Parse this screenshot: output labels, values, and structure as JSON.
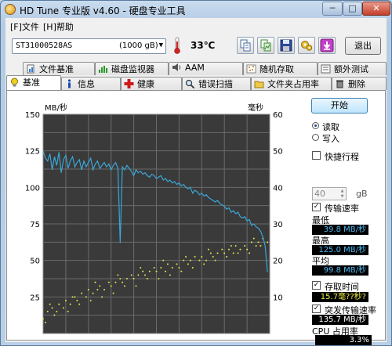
{
  "window": {
    "title": "HD Tune 专业版 v4.60 - 硬盘专业工具",
    "min_label": "─",
    "max_label": "□",
    "close_label": "✕"
  },
  "menu": [
    "[F]文件",
    "[H]帮助"
  ],
  "toolbar": {
    "drive_name": "ST31000528AS",
    "drive_capacity": "(1000 gB)",
    "temperature": "33℃",
    "exit_label": "退出",
    "buttons": [
      "copy-text-icon",
      "copy-screenshot-icon",
      "save-icon",
      "options-icon",
      "download-icon"
    ]
  },
  "tabs_row1": [
    "文件基准",
    "磁盘监视器",
    "AAM",
    "随机存取",
    "额外测试"
  ],
  "tabs_row2": [
    "基准",
    "信息",
    "健康",
    "错误扫描",
    "文件夹占用率",
    "删除"
  ],
  "side": {
    "start_label": "开始",
    "read_label": "读取",
    "write_label": "写入",
    "read_selected": true,
    "shortstroke_label": "快捷行程",
    "shortstroke_checked": false,
    "shortstroke_value": "40",
    "shortstroke_unit": "gB",
    "transfer_label": "传输速率",
    "transfer_checked": true,
    "min_label": "最低",
    "min_value": "39.8 MB/秒",
    "max_label": "最高",
    "max_value": "125.0 MB/秒",
    "avg_label": "平均",
    "avg_value": "99.8 MB/秒",
    "access_label": "存取时间",
    "access_checked": true,
    "access_value": "15.7毫??秒?",
    "burst_label": "突发传输速率",
    "burst_checked": true,
    "burst_value": "135.7 MB/秒",
    "cpu_label": "CPU 占用率",
    "cpu_value": "3.3%"
  },
  "colors": {
    "plot_bg": "#3a3a3a",
    "grid": "#6b6b6b",
    "transfer_line": "#3aa6d8",
    "access_dots": "#e6e650"
  },
  "chart_data": {
    "type": "line",
    "left_axis_label": "MB/秒",
    "right_axis_label": "毫秒",
    "y_left_ticks": [
      150,
      125,
      100,
      75,
      50,
      25
    ],
    "y_right_ticks": [
      60,
      50,
      40,
      30,
      20,
      10
    ],
    "y_left_range": [
      0,
      150
    ],
    "y_right_range": [
      0,
      60
    ],
    "x_range": [
      0,
      100
    ],
    "grid": true,
    "series": [
      {
        "name": "传输速率",
        "axis": "left",
        "x": [
          0,
          1,
          2,
          3,
          4,
          5,
          6,
          7,
          8,
          9,
          10,
          11,
          12,
          13,
          14,
          15,
          16,
          17,
          18,
          19,
          20,
          21,
          22,
          23,
          24,
          25,
          26,
          27,
          28,
          29,
          30,
          31,
          32,
          33,
          34,
          35,
          36,
          37,
          38,
          39,
          40,
          41,
          42,
          43,
          44,
          45,
          46,
          47,
          48,
          49,
          50,
          51,
          52,
          53,
          54,
          55,
          56,
          57,
          58,
          59,
          60,
          61,
          62,
          63,
          64,
          65,
          66,
          67,
          68,
          69,
          70,
          71,
          72,
          73,
          74,
          75,
          76,
          77,
          78,
          79,
          80,
          81,
          82,
          83,
          84,
          85,
          86,
          87,
          88,
          89,
          90,
          91,
          92,
          93,
          94,
          95,
          96,
          97,
          98,
          99
        ],
        "values": [
          125,
          120,
          118,
          123,
          112,
          121,
          115,
          124,
          110,
          119,
          122,
          113,
          118,
          121,
          114,
          117,
          119,
          112,
          118,
          114,
          117,
          120,
          112,
          116,
          118,
          113,
          115,
          117,
          114,
          116,
          112,
          115,
          117,
          113,
          62,
          114,
          112,
          115,
          113,
          111,
          108,
          112,
          110,
          111,
          109,
          110,
          108,
          107,
          109,
          108,
          106,
          107,
          108,
          105,
          106,
          104,
          105,
          103,
          104,
          102,
          103,
          101,
          102,
          100,
          99,
          100,
          96,
          98,
          97,
          95,
          96,
          94,
          95,
          93,
          92,
          91,
          90,
          91,
          89,
          88,
          87,
          85,
          86,
          83,
          84,
          82,
          83,
          80,
          79,
          80,
          77,
          78,
          74,
          75,
          73,
          72,
          70,
          66,
          60,
          42
        ]
      },
      {
        "name": "存取时间",
        "axis": "right",
        "type": "scatter",
        "x": [
          0,
          2,
          4,
          5,
          7,
          9,
          10,
          12,
          14,
          15,
          17,
          19,
          20,
          22,
          24,
          25,
          27,
          29,
          30,
          32,
          34,
          35,
          37,
          39,
          40,
          42,
          44,
          45,
          47,
          49,
          50,
          52,
          54,
          55,
          57,
          59,
          60,
          62,
          64,
          65,
          67,
          69,
          70,
          72,
          74,
          75,
          77,
          79,
          80,
          82,
          84,
          85,
          87,
          89,
          90,
          92,
          94,
          95,
          97,
          99,
          1,
          6,
          11,
          16,
          21,
          26,
          31,
          36,
          41,
          46,
          51,
          56,
          61,
          66,
          71,
          76,
          81,
          86,
          91,
          96,
          3,
          13,
          23,
          33,
          43,
          53,
          63,
          73,
          83,
          93
        ],
        "values": [
          4,
          6,
          7,
          5,
          8,
          7,
          9,
          8,
          10,
          9,
          11,
          10,
          12,
          11,
          12,
          13,
          12,
          14,
          13,
          14,
          15,
          14,
          15,
          16,
          15,
          16,
          17,
          16,
          17,
          18,
          17,
          18,
          17,
          19,
          18,
          19,
          18,
          20,
          19,
          20,
          21,
          20,
          21,
          20,
          22,
          21,
          22,
          23,
          22,
          23,
          22,
          24,
          23,
          24,
          23,
          25,
          24,
          25,
          26,
          25,
          3,
          6,
          6,
          8,
          9,
          10,
          11,
          13,
          13,
          15,
          15,
          16,
          17,
          18,
          19,
          20,
          21,
          22,
          22,
          24,
          8,
          10,
          14,
          16,
          18,
          20,
          21,
          23,
          24,
          26
        ]
      }
    ]
  }
}
